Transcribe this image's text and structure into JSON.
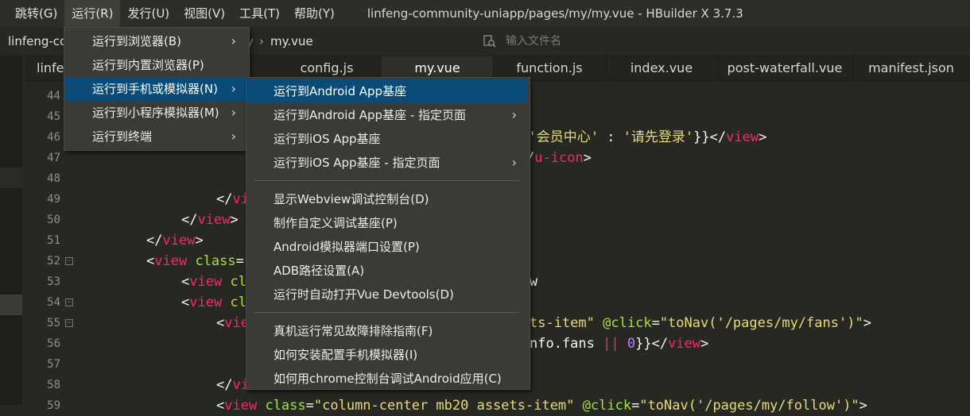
{
  "menubar": {
    "items": [
      {
        "label": "跳转(G)"
      },
      {
        "label": "运行(R)"
      },
      {
        "label": "发行(U)"
      },
      {
        "label": "视图(V)"
      },
      {
        "label": "工具(T)"
      },
      {
        "label": "帮助(Y)"
      }
    ],
    "window_title": "linfeng-community-uniapp/pages/my/my.vue - HBuilder X 3.7.3"
  },
  "pathbar": {
    "project": "linfeng-co",
    "slash": "y",
    "file": "my.vue",
    "search_placeholder": "输入文件名"
  },
  "tabs": [
    {
      "label": "linfe"
    },
    {
      "label": "config.js"
    },
    {
      "label": "my.vue"
    },
    {
      "label": "function.js"
    },
    {
      "label": "index.vue"
    },
    {
      "label": "post-waterfall.vue"
    },
    {
      "label": "manifest.json"
    }
  ],
  "editor": {
    "lines": [
      {
        "n": "44"
      },
      {
        "n": "45"
      },
      {
        "n": "46",
        "t": [
          [
            "str",
            "? '会员中心' "
          ],
          [
            "plain",
            ": "
          ],
          [
            "str",
            "'请先登录'"
          ],
          [
            "plain",
            "}}</"
          ],
          [
            "tag",
            "view"
          ],
          [
            "plain",
            ">"
          ]
        ]
      },
      {
        "n": "47",
        "t": [
          [
            "plain",
            "/"
          ],
          [
            "tag",
            "u-icon"
          ],
          [
            "plain",
            ">"
          ]
        ]
      },
      {
        "n": "48"
      },
      {
        "n": "49",
        "t": [
          [
            "plain",
            "</"
          ],
          [
            "tag",
            "vi"
          ]
        ]
      },
      {
        "n": "50",
        "t": [
          [
            "plain",
            "</"
          ],
          [
            "tag",
            "view"
          ],
          [
            "plain",
            ">"
          ]
        ]
      },
      {
        "n": "51",
        "t": [
          [
            "plain",
            "</"
          ],
          [
            "tag",
            "view"
          ],
          [
            "plain",
            ">"
          ]
        ]
      },
      {
        "n": "52",
        "t": [
          [
            "plain",
            "<"
          ],
          [
            "tag",
            "view"
          ],
          [
            "plain",
            " "
          ],
          [
            "attr",
            "class"
          ],
          [
            "plain",
            "="
          ]
        ]
      },
      {
        "n": "53",
        "t": [
          [
            "plain",
            "<"
          ],
          [
            "tag",
            "view"
          ],
          [
            "plain",
            " "
          ],
          [
            "attr",
            "cl"
          ]
        ]
      },
      {
        "n": "54",
        "t": [
          [
            "plain",
            "<"
          ],
          [
            "tag",
            "view"
          ],
          [
            "plain",
            " "
          ],
          [
            "attr",
            "cl"
          ]
        ]
      },
      {
        "n": "55",
        "t": [
          [
            "plain",
            "<"
          ],
          [
            "tag",
            "vie"
          ]
        ]
      },
      {
        "n": "56"
      },
      {
        "n": "57"
      },
      {
        "n": "58",
        "t": [
          [
            "plain",
            "</"
          ],
          [
            "tag",
            "vi"
          ]
        ]
      },
      {
        "n": "59",
        "t": [
          [
            "plain",
            "<"
          ],
          [
            "tag",
            "view"
          ],
          [
            "plain",
            " "
          ],
          [
            "attr",
            "class"
          ],
          [
            "plain",
            "="
          ],
          [
            "str",
            "\"column-center mb20 assets-item\""
          ],
          [
            "plain",
            " "
          ],
          [
            "attr",
            "@click"
          ],
          [
            "plain",
            "="
          ],
          [
            "str",
            "\"toNav('/pages/my/follow')\""
          ],
          [
            "plain",
            ">"
          ]
        ]
      }
    ],
    "right_fragments": {
      "l53": [
        [
          "plain",
          "w"
        ]
      ],
      "l55": [
        [
          "str",
          "ts-item\""
        ],
        [
          "plain",
          " "
        ],
        [
          "attr",
          "@click"
        ],
        [
          "plain",
          "="
        ],
        [
          "str",
          "\"toNav('/pages/my/fans')\""
        ],
        [
          "plain",
          ">"
        ]
      ],
      "l56": [
        [
          "plain",
          "nfo.fans "
        ],
        [
          "op",
          "||"
        ],
        [
          "plain",
          " "
        ],
        [
          "num",
          "0"
        ],
        [
          "plain",
          "}}</"
        ],
        [
          "tag",
          "view"
        ],
        [
          "plain",
          ">"
        ]
      ]
    }
  },
  "run_menu": {
    "items": [
      {
        "label": "运行到浏览器(B)",
        "submenu": true
      },
      {
        "label": "运行到内置浏览器(P)",
        "submenu": false
      },
      {
        "label": "运行到手机或模拟器(N)",
        "submenu": true
      },
      {
        "label": "运行到小程序模拟器(M)",
        "submenu": true
      },
      {
        "label": "运行到终端",
        "submenu": true
      }
    ],
    "highlighted_index": 2
  },
  "device_menu": {
    "groups": [
      [
        {
          "label": "运行到Android App基座",
          "submenu": false
        },
        {
          "label": "运行到Android App基座 - 指定页面",
          "submenu": true
        },
        {
          "label": "运行到iOS App基座",
          "submenu": false
        },
        {
          "label": "运行到iOS App基座 - 指定页面",
          "submenu": true
        }
      ],
      [
        {
          "label": "显示Webview调试控制台(D)",
          "submenu": false
        },
        {
          "label": "制作自定义调试基座(P)",
          "submenu": false
        },
        {
          "label": "Android模拟器端口设置(P)",
          "submenu": false
        },
        {
          "label": "ADB路径设置(A)",
          "submenu": false
        },
        {
          "label": "运行时自动打开Vue Devtools(D)",
          "submenu": false
        }
      ],
      [
        {
          "label": "真机运行常见故障排除指南(F)",
          "submenu": false
        },
        {
          "label": "如何安装配置手机模拟器(I)",
          "submenu": false
        },
        {
          "label": "如何用chrome控制台调试Android应用(C)",
          "submenu": false
        }
      ]
    ],
    "highlighted": "运行到Android App基座"
  },
  "colors": {
    "background": "#272822",
    "menu_bg": "#3a3b35",
    "highlight": "#0b4b78",
    "tag": "#f92672",
    "attr": "#a6e22e",
    "string": "#e6db74",
    "number": "#ae81ff"
  }
}
